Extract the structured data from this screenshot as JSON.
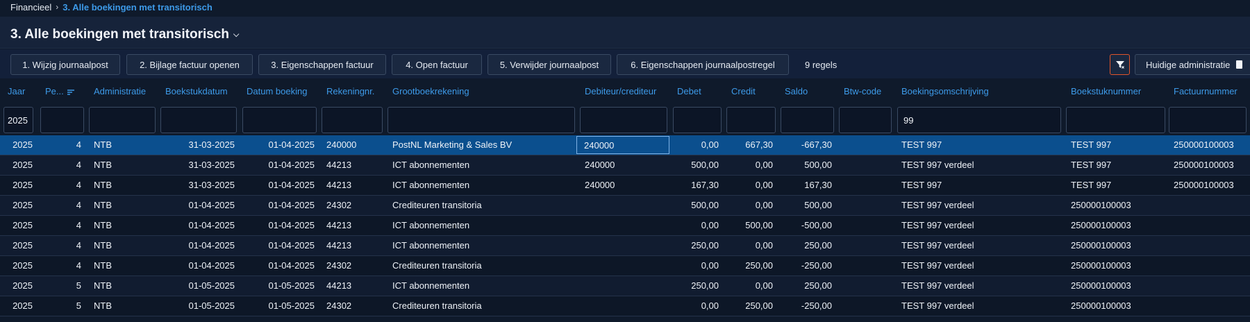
{
  "breadcrumb": {
    "root": "Financieel",
    "current": "3. Alle boekingen met transitorisch"
  },
  "page": {
    "title": "3. Alle boekingen met transitorisch"
  },
  "toolbar": {
    "buttons": [
      "1. Wijzig journaalpost",
      "2. Bijlage factuur openen",
      "3. Eigenschappen factuur",
      "4. Open factuur",
      "5. Verwijder journaalpost",
      "6. Eigenschappen journaalpostregel"
    ],
    "row_count": "9 regels",
    "admin_label": "Huidige administratie",
    "filter_active_color": "#e0552a"
  },
  "columns": [
    "Jaar",
    "Pe...",
    "Administratie",
    "Boekstukdatum",
    "Datum boeking",
    "Rekeningnr.",
    "Grootboekrekening",
    "Debiteur/crediteur",
    "Debet",
    "Credit",
    "Saldo",
    "Btw-code",
    "Boekingsomschrijving",
    "Boekstuknummer",
    "Factuurnummer"
  ],
  "filters": {
    "jaar": "2025",
    "boekingsomschrijving": "99"
  },
  "rows": [
    [
      "2025",
      "4",
      "NTB",
      "31-03-2025",
      "01-04-2025",
      "240000",
      "PostNL Marketing & Sales BV",
      "240000",
      "0,00",
      "667,30",
      "-667,30",
      "",
      "TEST 997",
      "TEST 997",
      "250000100003"
    ],
    [
      "2025",
      "4",
      "NTB",
      "31-03-2025",
      "01-04-2025",
      "44213",
      "ICT abonnementen",
      "240000",
      "500,00",
      "0,00",
      "500,00",
      "",
      "TEST 997 verdeel",
      "TEST 997",
      "250000100003"
    ],
    [
      "2025",
      "4",
      "NTB",
      "31-03-2025",
      "01-04-2025",
      "44213",
      "ICT abonnementen",
      "240000",
      "167,30",
      "0,00",
      "167,30",
      "",
      "TEST 997",
      "TEST 997",
      "250000100003"
    ],
    [
      "2025",
      "4",
      "NTB",
      "01-04-2025",
      "01-04-2025",
      "24302",
      "Crediteuren transitoria",
      "",
      "500,00",
      "0,00",
      "500,00",
      "",
      "TEST 997 verdeel",
      "250000100003",
      ""
    ],
    [
      "2025",
      "4",
      "NTB",
      "01-04-2025",
      "01-04-2025",
      "44213",
      "ICT abonnementen",
      "",
      "0,00",
      "500,00",
      "-500,00",
      "",
      "TEST 997 verdeel",
      "250000100003",
      ""
    ],
    [
      "2025",
      "4",
      "NTB",
      "01-04-2025",
      "01-04-2025",
      "44213",
      "ICT abonnementen",
      "",
      "250,00",
      "0,00",
      "250,00",
      "",
      "TEST 997 verdeel",
      "250000100003",
      ""
    ],
    [
      "2025",
      "4",
      "NTB",
      "01-04-2025",
      "01-04-2025",
      "24302",
      "Crediteuren transitoria",
      "",
      "0,00",
      "250,00",
      "-250,00",
      "",
      "TEST 997 verdeel",
      "250000100003",
      ""
    ],
    [
      "2025",
      "5",
      "NTB",
      "01-05-2025",
      "01-05-2025",
      "44213",
      "ICT abonnementen",
      "",
      "250,00",
      "0,00",
      "250,00",
      "",
      "TEST 997 verdeel",
      "250000100003",
      ""
    ],
    [
      "2025",
      "5",
      "NTB",
      "01-05-2025",
      "01-05-2025",
      "24302",
      "Crediteuren transitoria",
      "",
      "0,00",
      "250,00",
      "-250,00",
      "",
      "TEST 997 verdeel",
      "250000100003",
      ""
    ]
  ]
}
